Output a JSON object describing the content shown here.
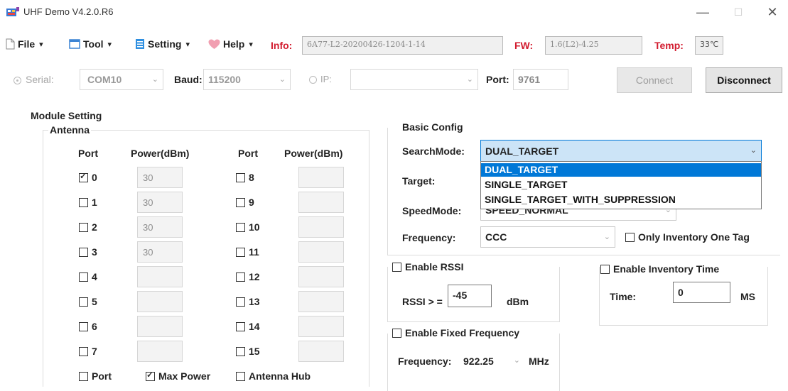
{
  "window": {
    "title": "UHF Demo V4.2.0.R6",
    "minimize": "—",
    "maximize": "☐",
    "close": "✕"
  },
  "menu": {
    "file": "File",
    "tool": "Tool",
    "setting": "Setting",
    "help": "Help",
    "caret": "▾",
    "info_label": "Info:",
    "info_value": "6A77-L2-20200426-1204-1-14",
    "fw_label": "FW:",
    "fw_value": "1.6(L2)-4.25",
    "temp_label": "Temp:",
    "temp_value": "33℃"
  },
  "connection": {
    "serial_label": "Serial:",
    "serial_port": "COM10",
    "baud_label": "Baud:",
    "baud_value": "115200",
    "ip_label": "IP:",
    "ip_value": "",
    "port_label": "Port:",
    "port_value": "9761",
    "connect_label": "Connect",
    "disconnect_label": "Disconnect"
  },
  "module": {
    "title": "Module Setting",
    "antenna_title": "Antenna",
    "col_port": "Port",
    "col_power": "Power(dBm)",
    "ports_left": [
      {
        "label": "0",
        "checked": true,
        "power": "30"
      },
      {
        "label": "1",
        "checked": false,
        "power": "30"
      },
      {
        "label": "2",
        "checked": false,
        "power": "30"
      },
      {
        "label": "3",
        "checked": false,
        "power": "30"
      },
      {
        "label": "4",
        "checked": false,
        "power": ""
      },
      {
        "label": "5",
        "checked": false,
        "power": ""
      },
      {
        "label": "6",
        "checked": false,
        "power": ""
      },
      {
        "label": "7",
        "checked": false,
        "power": ""
      }
    ],
    "ports_right": [
      {
        "label": "8",
        "checked": false,
        "power": ""
      },
      {
        "label": "9",
        "checked": false,
        "power": ""
      },
      {
        "label": "10",
        "checked": false,
        "power": ""
      },
      {
        "label": "11",
        "checked": false,
        "power": ""
      },
      {
        "label": "12",
        "checked": false,
        "power": ""
      },
      {
        "label": "13",
        "checked": false,
        "power": ""
      },
      {
        "label": "14",
        "checked": false,
        "power": ""
      },
      {
        "label": "15",
        "checked": false,
        "power": ""
      }
    ],
    "bottom": {
      "port_label": "Port",
      "port_checked": false,
      "max_power_label": "Max Power",
      "max_power_checked": true,
      "antenna_hub_label": "Antenna Hub",
      "antenna_hub_checked": false
    }
  },
  "basic_config": {
    "title": "Basic Config",
    "search_mode_label": "SearchMode:",
    "search_mode_value": "DUAL_TARGET",
    "search_mode_options": [
      "DUAL_TARGET",
      "SINGLE_TARGET",
      "SINGLE_TARGET_WITH_SUPPRESSION"
    ],
    "search_mode_highlighted": 0,
    "target_label": "Target:",
    "speed_mode_label": "SpeedMode:",
    "speed_mode_value": "SPEED_NORMAL",
    "frequency_label": "Frequency:",
    "frequency_value": "CCC",
    "only_one_tag_label": "Only Inventory One Tag",
    "only_one_tag_checked": false
  },
  "rssi": {
    "enable_label": "Enable RSSI",
    "checked": false,
    "rssi_label": "RSSI > =",
    "rssi_value": "-45",
    "unit": "dBm"
  },
  "inventory_time": {
    "enable_label": "Enable Inventory Time",
    "checked": false,
    "time_label": "Time:",
    "time_value": "0",
    "unit": "MS"
  },
  "fixed_frequency": {
    "enable_label": "Enable Fixed Frequency",
    "checked": false,
    "frequency_label": "Frequency:",
    "frequency_value": "922.25",
    "unit": "MHz"
  },
  "colors": {
    "info_red": "#d21c2f",
    "selection_blue": "#0078d7",
    "combo_focus": "#cce4f7"
  }
}
